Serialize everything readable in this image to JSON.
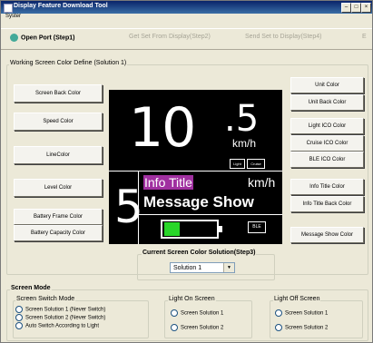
{
  "window": {
    "title": "Display Feature Download Tool"
  },
  "menu": {
    "system": "Syster"
  },
  "toolbar": {
    "open_port": "Open Port (Step1)",
    "get_set": "Get Set From Display(Step2)",
    "send_set": "Send Set to Display(Step4)",
    "more": "E"
  },
  "working_group": {
    "title": "Working Screen Color Define (Solution 1)"
  },
  "left_buttons": {
    "screen_back": "Screen Back Color",
    "speed": "Speed Color",
    "line": "LineColor",
    "level": "Level Color",
    "battery_frame": "Battery Frame Color",
    "battery_capacity": "Battery Capacity Color"
  },
  "right_buttons": {
    "unit": "Unit Color",
    "unit_back": "Unit Back Color",
    "light_icon": "Light ICO Color",
    "cruise_icon": "Cruise ICO Color",
    "ble_icon": "BLE ICO Color",
    "info_title": "Info Title Color",
    "info_title_back": "Info Title Back Color",
    "message_show": "Message Show Color"
  },
  "preview": {
    "speed_int": "10",
    "speed_dec": ".5",
    "unit_top": "km/h",
    "mini_light": "Light",
    "mini_cruise": "Cruise",
    "level": "5",
    "info_title": "Info Title",
    "unit_bottom": "km/h",
    "message": "Message Show",
    "ble": "BLE",
    "battery_fill_fraction": 0.33
  },
  "solution": {
    "label": "Current Screen Color Solution(Step3)",
    "value": "Solution 1"
  },
  "screen_mode": {
    "title": "Screen Mode",
    "switch_group": {
      "title": "Screen Switch Mode",
      "options": [
        "Screen Solution 1 (Never Switch)",
        "Screen Solution 2 (Never Switch)",
        "Auto Switch According to Light"
      ]
    },
    "light_on": {
      "title": "Light On Screen",
      "options": [
        "Screen Solution 1",
        "Screen Solution 2"
      ]
    },
    "light_off": {
      "title": "Light Off Screen",
      "options": [
        "Screen Solution 1",
        "Screen Solution 2"
      ]
    }
  },
  "colors": {
    "titlebar": "#0a246a",
    "battery": "#29d629",
    "info_title_back": "#a030a0",
    "screen_back": "#000000"
  }
}
